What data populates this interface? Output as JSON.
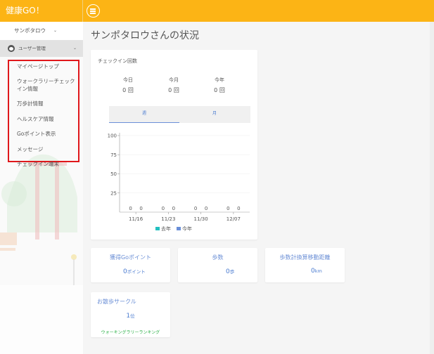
{
  "app": {
    "brand": "健康GO！"
  },
  "sidebar": {
    "user_label": "サンポタロウ",
    "admin_label": "ユーザー管理",
    "items": [
      {
        "label": "マイページトップ"
      },
      {
        "label": "ウォークラリーチェックイン情報"
      },
      {
        "label": "万歩計情報"
      },
      {
        "label": "ヘルスケア情報"
      },
      {
        "label": "Goポイント表示"
      },
      {
        "label": "メッセージ"
      },
      {
        "label": "チェックイン端末"
      }
    ]
  },
  "main": {
    "title": "サンポタロウさんの状況",
    "checkin": {
      "title": "チェックイン回数",
      "stats": [
        {
          "label": "今日",
          "value": "0",
          "unit": "回"
        },
        {
          "label": "今月",
          "value": "0",
          "unit": "回"
        },
        {
          "label": "今年",
          "value": "0",
          "unit": "回"
        }
      ],
      "tabs": [
        {
          "label": "週"
        },
        {
          "label": "月"
        }
      ],
      "active_tab": "週"
    },
    "points": {
      "title": "獲得Goポイント",
      "value": "0",
      "unit": "ポイント"
    },
    "steps": {
      "title": "歩数",
      "value": "0",
      "unit": "歩"
    },
    "distance": {
      "title": "歩数計換算移動距離",
      "value": "0",
      "unit": "km"
    },
    "circle": {
      "title": "お散歩サークル",
      "value": "1",
      "unit": "位",
      "link": "ウォーキングラリーランキング"
    }
  },
  "colors": {
    "topbar": "#fcb415",
    "last_year": "#22c0c0",
    "this_year": "#6a8fd8",
    "highlight_box": "#e0171b"
  },
  "chart_data": {
    "type": "bar",
    "categories": [
      "11/16",
      "11/23",
      "11/30",
      "12/07"
    ],
    "series": [
      {
        "name": "去年",
        "values": [
          0,
          0,
          0,
          0
        ]
      },
      {
        "name": "今年",
        "values": [
          0,
          0,
          0,
          0
        ]
      }
    ],
    "yticks": [
      25,
      50,
      75,
      100
    ],
    "ylim": [
      0,
      100
    ],
    "legend": "bottom",
    "grid": true
  }
}
